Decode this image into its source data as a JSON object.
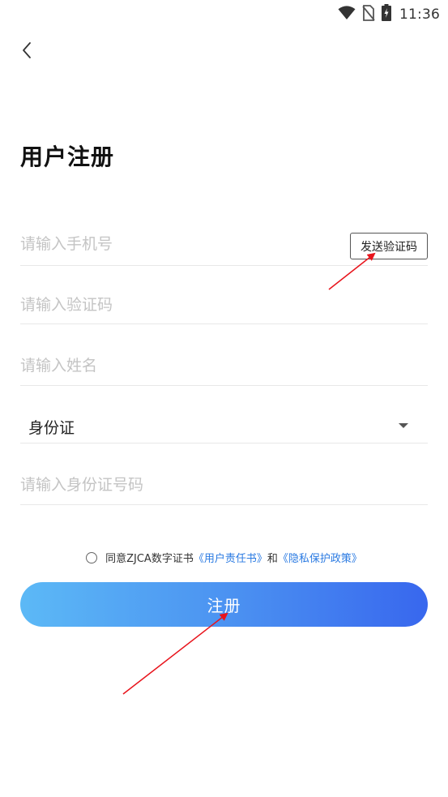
{
  "status_bar": {
    "time": "11:36",
    "icons": [
      "wifi-icon",
      "no-sim-icon",
      "battery-charging-icon"
    ]
  },
  "header": {
    "back_icon": "chevron-left-icon",
    "title": "用户注册"
  },
  "form": {
    "phone": {
      "placeholder": "请输入手机号",
      "value": ""
    },
    "send_code_label": "发送验证码",
    "code": {
      "placeholder": "请输入验证码",
      "value": ""
    },
    "name": {
      "placeholder": "请输入姓名",
      "value": ""
    },
    "id_type": {
      "selected": "身份证"
    },
    "id_number": {
      "placeholder": "请输入身份证号码",
      "value": ""
    }
  },
  "agreement": {
    "prefix": "同意ZJCA数字证书",
    "link1": "《用户责任书》",
    "conjunction": "和",
    "link2": "《隐私保护政策》",
    "checked": false,
    "link_color": "#2a7ae2"
  },
  "register_label": "注册",
  "colors": {
    "button_gradient_start": "#5cb9f6",
    "button_gradient_end": "#3867ee",
    "annotation_arrow": "#e8141c"
  }
}
